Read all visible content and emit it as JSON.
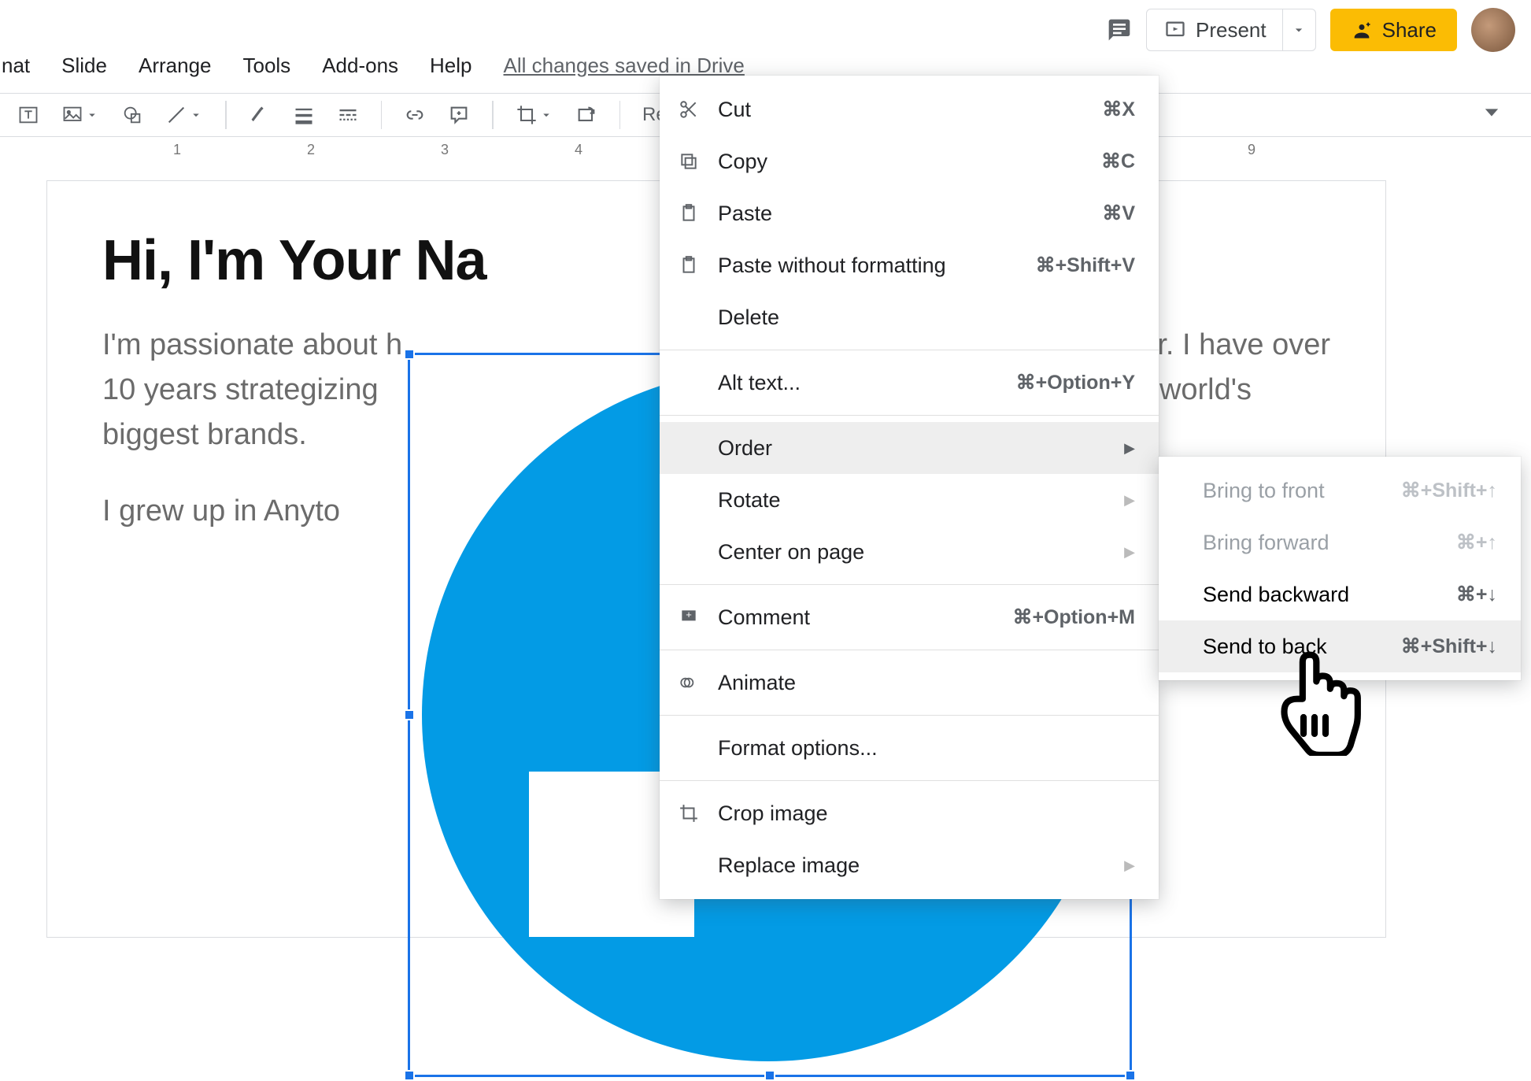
{
  "header": {
    "present_label": "Present",
    "share_label": "Share"
  },
  "menubar": {
    "format": "nat",
    "slide": "Slide",
    "arrange": "Arrange",
    "tools": "Tools",
    "addons": "Add-ons",
    "help": "Help",
    "savestate": "All changes saved in Drive"
  },
  "toolbar": {
    "reset_label": "Re"
  },
  "ruler": {
    "marks": [
      1,
      2,
      3,
      4,
      9
    ]
  },
  "slide": {
    "title": "Hi, I'm Your Na",
    "p1_line1": "I'm passionate about h",
    "p1_right1": "r. I have over",
    "p1_line2": "10 years strategizing",
    "p1_right2": "world's",
    "p1_line3": "biggest brands.",
    "p2": "I grew up in Anyto"
  },
  "context_menu": {
    "cut": {
      "label": "Cut",
      "shortcut": "⌘X"
    },
    "copy": {
      "label": "Copy",
      "shortcut": "⌘C"
    },
    "paste": {
      "label": "Paste",
      "shortcut": "⌘V"
    },
    "paste_without_fmt": {
      "label": "Paste without formatting",
      "shortcut": "⌘+Shift+V"
    },
    "delete": {
      "label": "Delete"
    },
    "alt_text": {
      "label": "Alt text...",
      "shortcut": "⌘+Option+Y"
    },
    "order": {
      "label": "Order"
    },
    "rotate": {
      "label": "Rotate"
    },
    "center": {
      "label": "Center on page"
    },
    "comment": {
      "label": "Comment",
      "shortcut": "⌘+Option+M"
    },
    "animate": {
      "label": "Animate"
    },
    "format_options": {
      "label": "Format options..."
    },
    "crop_image": {
      "label": "Crop image"
    },
    "replace_image": {
      "label": "Replace image"
    }
  },
  "submenu_order": {
    "bring_front": {
      "label": "Bring to front",
      "shortcut": "⌘+Shift+↑"
    },
    "bring_forward": {
      "label": "Bring forward",
      "shortcut": "⌘+↑"
    },
    "send_backward": {
      "label": "Send backward",
      "shortcut": "⌘+↓"
    },
    "send_back": {
      "label": "Send to back",
      "shortcut": "⌘+Shift+↓"
    }
  }
}
